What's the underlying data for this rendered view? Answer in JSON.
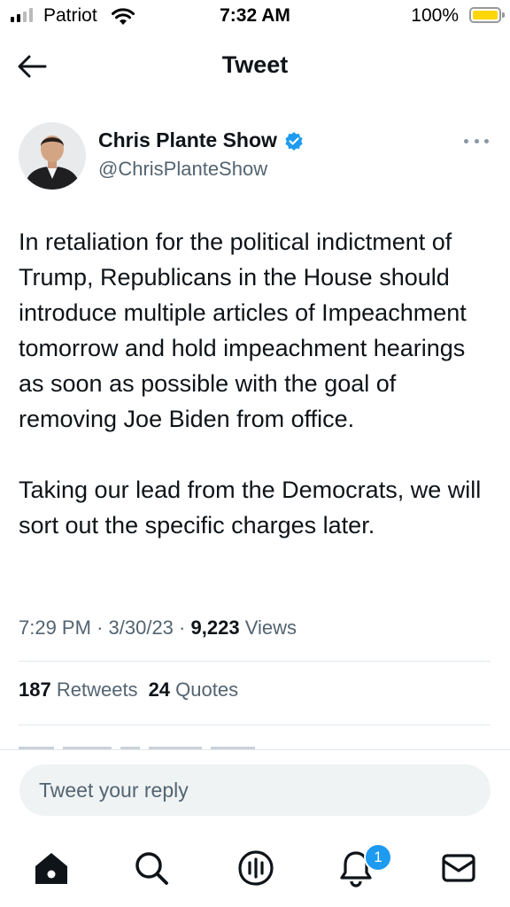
{
  "status_bar": {
    "carrier": "Patriot",
    "time": "7:32 AM",
    "battery_percent": "100%",
    "battery_level": 1.0,
    "signal_bars_active": 2,
    "signal_bars_total": 4
  },
  "header": {
    "title": "Tweet",
    "back_icon": "arrow-left-icon"
  },
  "tweet": {
    "author_name": "Chris Plante Show",
    "verified": true,
    "handle": "@ChrisPlanteShow",
    "paragraphs": [
      "In retaliation for the political indictment of Trump, Republicans in the House should introduce multiple articles of Impeachment tomorrow and hold impeachment hearings as soon as possible with the goal of removing Joe Biden from office.",
      "Taking our lead from the Democrats, we will sort out the specific charges later."
    ],
    "time": "7:29 PM",
    "date": "3/30/23",
    "views_count": "9,223",
    "views_label": "Views",
    "separator": "·",
    "retweets_count": "187",
    "retweets_label": "Retweets",
    "quotes_count": "24",
    "quotes_label": "Quotes"
  },
  "reply": {
    "placeholder": "Tweet your reply"
  },
  "tabbar": {
    "items": [
      {
        "name": "home-icon"
      },
      {
        "name": "search-icon"
      },
      {
        "name": "spaces-icon"
      },
      {
        "name": "notifications-icon"
      },
      {
        "name": "messages-icon"
      }
    ],
    "notification_badge": "1"
  },
  "colors": {
    "accent": "#1d9bf0",
    "text": "#0f1419",
    "secondary_text": "#536471",
    "battery": "#ffd60a",
    "reply_bg": "#eff3f4",
    "divider": "#e1e8ed"
  }
}
